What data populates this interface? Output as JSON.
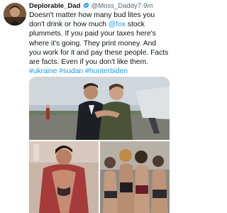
{
  "tweet": {
    "author_name": "Deplorable_Dad",
    "handle": "@Moss_Daddy7",
    "separator": "·",
    "time": "9m",
    "text_1": "Doesn't matter how many bud lites you don't drink or how much ",
    "mention": "@fox",
    "text_2": " stock plummets. If you paid your taxes here's where it's going. They print money. And you work for it and pay these people. Facts are facts. Even if you don't like them. ",
    "hashtag_1": "#ukraine",
    "hashtag_2": "#sudan",
    "hashtag_3": "#hunterbiden"
  },
  "colors": {
    "link": "#1d9bf0",
    "text": "#0f1419",
    "secondary": "#536471"
  },
  "icons": {
    "verified": "verified-badge-icon"
  }
}
